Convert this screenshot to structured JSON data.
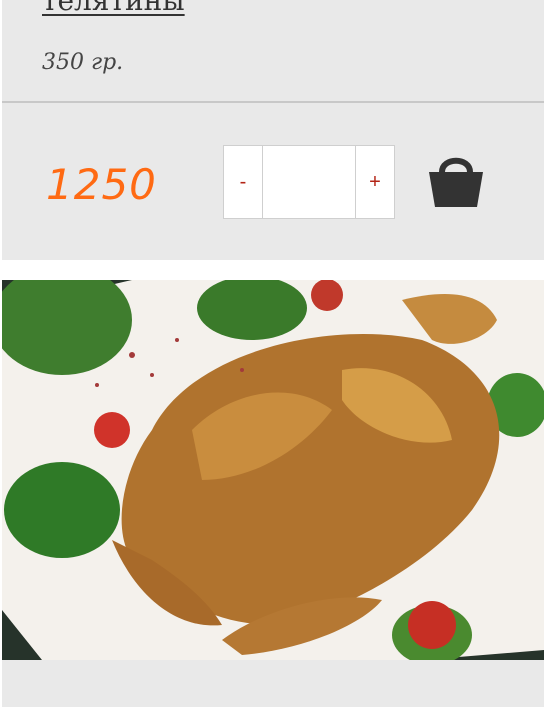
{
  "product": {
    "title": "телятины",
    "weight": "350 гр.",
    "price": "1250"
  },
  "quantity": {
    "minus_label": "-",
    "plus_label": "+",
    "value": ""
  },
  "icons": {
    "cart": "shopping-basket-icon"
  },
  "colors": {
    "price": "#ff6a13",
    "qty_buttons": "#b32416",
    "card_background": "#e9e9e9"
  }
}
